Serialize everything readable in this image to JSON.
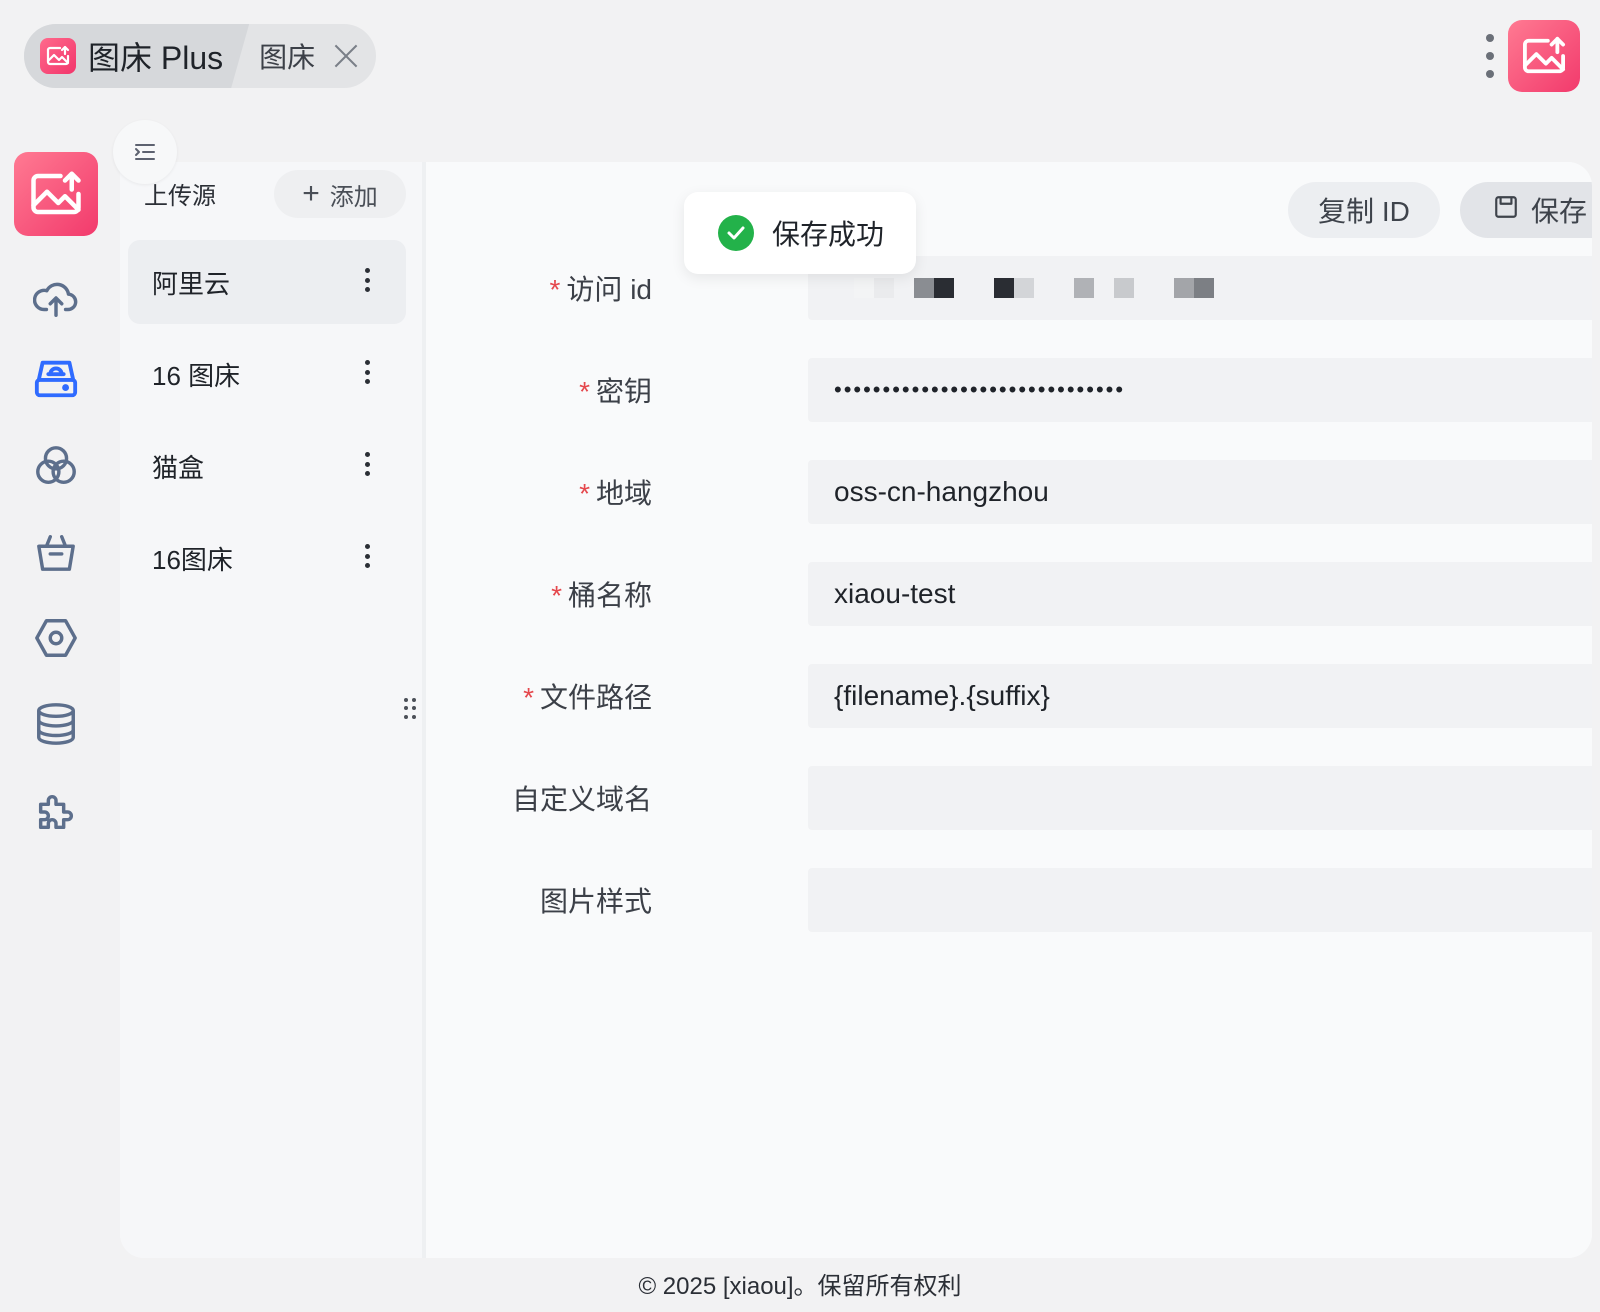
{
  "tabs": {
    "app_title": "图床 Plus",
    "active_tab": "图床"
  },
  "sources": {
    "header_label": "上传源",
    "add_label": "添加",
    "items": [
      {
        "label": "阿里云"
      },
      {
        "label": "16 图床"
      },
      {
        "label": "猫盒"
      },
      {
        "label": "16图床"
      }
    ]
  },
  "actions": {
    "copy_id_label": "复制 ID",
    "save_label": "保存"
  },
  "toast": {
    "message": "保存成功"
  },
  "form": {
    "access_id": {
      "label": "访问 id",
      "required": true,
      "value": ""
    },
    "secret": {
      "label": "密钥",
      "required": true,
      "value": "••••••••••••••••••••••••••••••"
    },
    "region": {
      "label": "地域",
      "required": true,
      "value": "oss-cn-hangzhou"
    },
    "bucket": {
      "label": "桶名称",
      "required": true,
      "value": "xiaou-test"
    },
    "path": {
      "label": "文件路径",
      "required": true,
      "value": "{filename}.{suffix}"
    },
    "custom_domain": {
      "label": "自定义域名",
      "required": false,
      "value": ""
    },
    "image_style": {
      "label": "图片样式",
      "required": false,
      "value": ""
    }
  },
  "footer": {
    "text": "© 2025 [xiaou]。保留所有权利"
  },
  "icons": {
    "rail": [
      "image-upload-logo-icon",
      "cloud-upload-icon",
      "storage-drive-icon",
      "circles-icon",
      "basket-icon",
      "hexagon-settings-icon",
      "database-icon",
      "plugin-puzzle-icon"
    ]
  },
  "colors": {
    "brand": "#f23a6c",
    "active_rail": "#2f6bff",
    "success": "#23b24a",
    "required": "#e5484d"
  }
}
